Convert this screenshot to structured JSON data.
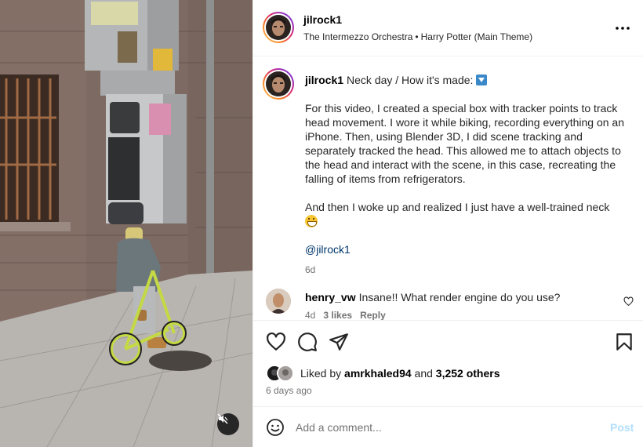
{
  "post": {
    "username": "jilrock1",
    "audio": {
      "artist": "The Intermezzo Orchestra",
      "separator": "•",
      "track": "Harry Potter (Main Theme)"
    }
  },
  "caption": {
    "username": "jilrock1",
    "title": "Neck day / How it's made:",
    "paragraph_1": "For this video, I created a special box with tracker points to track head movement. I wore it while biking, recording everything on an iPhone. Then, using Blender 3D, I did scene tracking and separately tracked the head. This allowed me to attach objects to the head and interact with the scene, in this case, recreating the falling of items from refrigerators.",
    "paragraph_2": "And then I woke up and realized I just have a well-trained neck",
    "mention": "@jilrock1",
    "age": "6d"
  },
  "comments": [
    {
      "username": "henry_vw",
      "text": "Insane!! What render engine do you use?",
      "age": "4d",
      "likes": "3 likes",
      "reply_label": "Reply"
    }
  ],
  "likes": {
    "prefix": "Liked by",
    "first_liker": "amrkhaled94",
    "conjunction": "and",
    "others": "3,252 others"
  },
  "post_age": "6 days ago",
  "composer": {
    "placeholder": "Add a comment...",
    "post_label": "Post"
  },
  "icons": {
    "more": "more-horizontal-icon",
    "like": "heart-icon",
    "comment": "comment-icon",
    "share": "paper-plane-icon",
    "save": "bookmark-icon",
    "emoji": "smiley-icon",
    "mute": "speaker-muted-icon"
  },
  "colors": {
    "link": "#00376b",
    "secondary_text": "#737373",
    "post_disabled": "#b2dffc",
    "divider": "#efefef"
  }
}
